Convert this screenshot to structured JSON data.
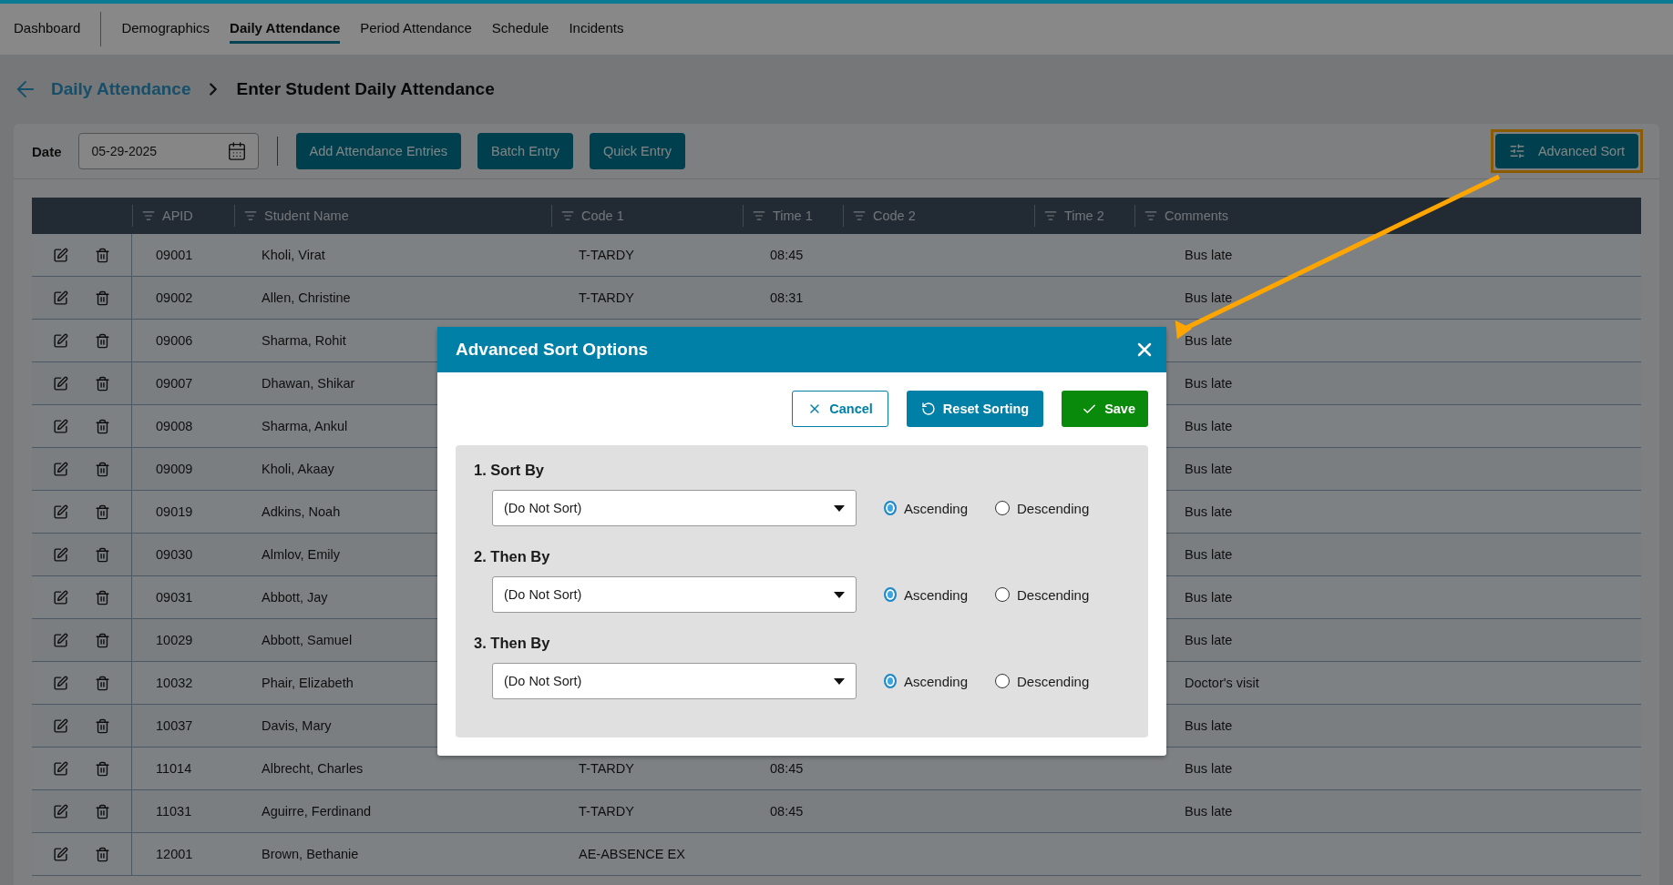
{
  "nav": {
    "tabs": [
      {
        "label": "Dashboard",
        "selected": false
      },
      {
        "label": "Demographics",
        "selected": false
      },
      {
        "label": "Daily Attendance",
        "selected": true
      },
      {
        "label": "Period Attendance",
        "selected": false
      },
      {
        "label": "Schedule",
        "selected": false
      },
      {
        "label": "Incidents",
        "selected": false
      }
    ]
  },
  "breadcrumb": {
    "parent": "Daily Attendance",
    "current": "Enter Student Daily Attendance"
  },
  "toolbar": {
    "date_label": "Date",
    "date_value": "05-29-2025",
    "buttons": [
      "Add Attendance Entries",
      "Batch Entry",
      "Quick Entry"
    ],
    "advanced_sort": "Advanced Sort"
  },
  "table": {
    "columns": [
      "APID",
      "Student Name",
      "Code 1",
      "Time 1",
      "Code 2",
      "Time 2",
      "Comments"
    ],
    "rows": [
      {
        "apid": "09001",
        "name": "Kholi, Virat",
        "code_1": "T-TARDY",
        "time_1": "08:45",
        "comments": "Bus late"
      },
      {
        "apid": "09002",
        "name": "Allen, Christine",
        "code_1": "T-TARDY",
        "time_1": "08:31",
        "comments": "Bus late"
      },
      {
        "apid": "09006",
        "name": "Sharma, Rohit",
        "comments": "Bus late"
      },
      {
        "apid": "09007",
        "name": "Dhawan, Shikar",
        "comments": "Bus late"
      },
      {
        "apid": "09008",
        "name": "Sharma, Ankul",
        "comments": "Bus late"
      },
      {
        "apid": "09009",
        "name": "Kholi, Akaay",
        "comments": "Bus late"
      },
      {
        "apid": "09019",
        "name": "Adkins, Noah",
        "comments": "Bus late"
      },
      {
        "apid": "09030",
        "name": "Almlov, Emily",
        "comments": "Bus late"
      },
      {
        "apid": "09031",
        "name": "Abbott, Jay",
        "comments": "Bus late"
      },
      {
        "apid": "10029",
        "name": "Abbott, Samuel",
        "comments": "Bus late"
      },
      {
        "apid": "10032",
        "name": "Phair, Elizabeth",
        "comments": "Doctor's visit"
      },
      {
        "apid": "10037",
        "name": "Davis, Mary",
        "comments": "Bus late"
      },
      {
        "apid": "11014",
        "name": "Albrecht, Charles",
        "code_1": "T-TARDY",
        "time_1": "08:45",
        "comments": "Bus late"
      },
      {
        "apid": "11031",
        "name": "Aguirre, Ferdinand",
        "code_1": "T-TARDY",
        "time_1": "08:45",
        "comments": "Bus late"
      },
      {
        "apid": "12001",
        "name": "Brown, Bethanie",
        "code_1": "AE-ABSENCE EX"
      }
    ]
  },
  "dialog": {
    "title": "Advanced Sort Options",
    "cancel": "Cancel",
    "reset": "Reset Sorting",
    "save": "Save",
    "sort_levels": [
      {
        "label": "1. Sort By",
        "value": "(Do Not Sort)",
        "orders": [
          {
            "label": "Ascending",
            "selected": true
          },
          {
            "label": "Descending",
            "selected": false
          }
        ]
      },
      {
        "label": "2. Then By",
        "value": "(Do Not Sort)",
        "orders": [
          {
            "label": "Ascending",
            "selected": true
          },
          {
            "label": "Descending",
            "selected": false
          }
        ]
      },
      {
        "label": "3. Then By",
        "value": "(Do Not Sort)",
        "orders": [
          {
            "label": "Ascending",
            "selected": true
          },
          {
            "label": "Descending",
            "selected": false
          }
        ]
      }
    ]
  }
}
